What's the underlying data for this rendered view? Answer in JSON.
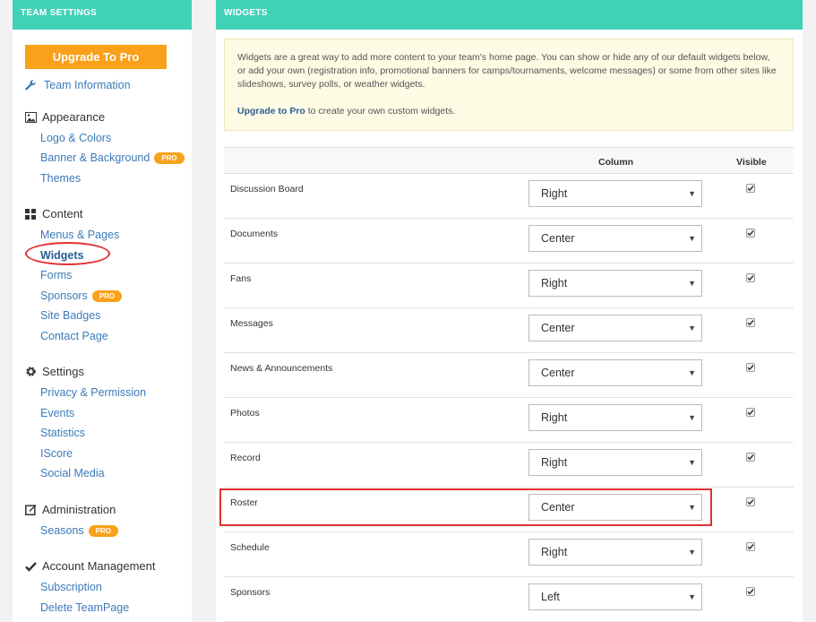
{
  "sidebar": {
    "header": "TEAM SETTINGS",
    "upgrade_label": "Upgrade To Pro",
    "team_info": "Team Information",
    "sections": {
      "appearance": "Appearance",
      "content": "Content",
      "settings": "Settings",
      "administration": "Administration",
      "account": "Account Management"
    },
    "links": {
      "logo_colors": "Logo & Colors",
      "banner_background": "Banner & Background",
      "themes": "Themes",
      "menus_pages": "Menus & Pages",
      "widgets": "Widgets",
      "forms": "Forms",
      "sponsors": "Sponsors",
      "site_badges": "Site Badges",
      "contact_page": "Contact Page",
      "privacy_permission": "Privacy & Permission",
      "events": "Events",
      "statistics": "Statistics",
      "iscore": "IScore",
      "social_media": "Social Media",
      "seasons": "Seasons",
      "subscription": "Subscription",
      "delete_teampage": "Delete TeamPage"
    },
    "pro_badge": "PRO"
  },
  "main": {
    "header": "WIDGETS",
    "info_text": "Widgets are a great way to add more content to your team's home page. You can show or hide any of our default widgets below, or add your own (registration info, promotional banners for camps/tournaments, welcome messages) or some from other sites like slideshows, survey polls, or weather widgets.",
    "upgrade_link": "Upgrade to Pro",
    "upgrade_suffix": " to create your own custom widgets.",
    "col_column": "Column",
    "col_visible": "Visible",
    "rows": [
      {
        "name": "Discussion Board",
        "column": "Right",
        "visible": true
      },
      {
        "name": "Documents",
        "column": "Center",
        "visible": true
      },
      {
        "name": "Fans",
        "column": "Right",
        "visible": true
      },
      {
        "name": "Messages",
        "column": "Center",
        "visible": true
      },
      {
        "name": "News & Announcements",
        "column": "Center",
        "visible": true
      },
      {
        "name": "Photos",
        "column": "Right",
        "visible": true
      },
      {
        "name": "Record",
        "column": "Right",
        "visible": true
      },
      {
        "name": "Roster",
        "column": "Center",
        "visible": true
      },
      {
        "name": "Schedule",
        "column": "Right",
        "visible": true
      },
      {
        "name": "Sponsors",
        "column": "Left",
        "visible": true
      }
    ]
  },
  "colors": {
    "header_teal": "#41d1b6",
    "upgrade_orange": "#f9a11b",
    "link_blue": "#3d7ab8",
    "highlight_red": "#e03131"
  }
}
